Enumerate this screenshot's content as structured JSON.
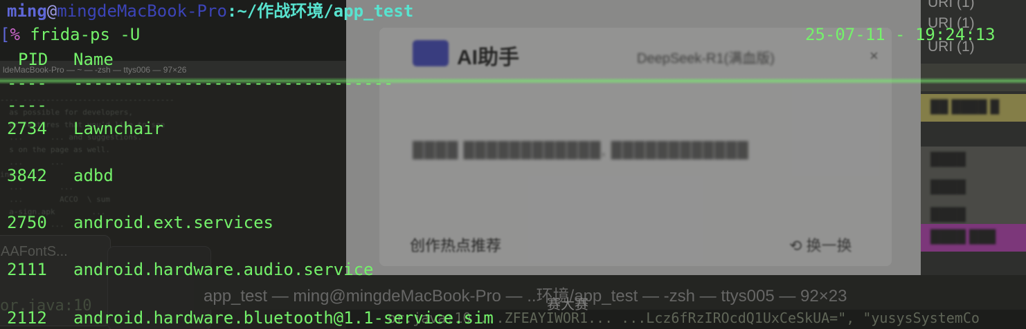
{
  "terminal": {
    "prompt": {
      "user": "ming",
      "at": "@",
      "host": "mingdeMacBook-Pro",
      "path": ":~/作战环境/app_test",
      "bracket": "[",
      "symbol": "%",
      "command": " frida-ps -U"
    },
    "clock": "25-07-11 - 19:24:13",
    "table": {
      "header_pid": "PID",
      "header_name": "Name",
      "separator_pid": "----",
      "separator_name": "--------------------------------",
      "separator_wrap": "----",
      "rows": [
        {
          "pid": "2734",
          "name": "Lawnchair"
        },
        {
          "pid": "3842",
          "name": "adbd"
        },
        {
          "pid": "2750",
          "name": "android.ext.services"
        },
        {
          "pid": "2111",
          "name": "android.hardware.audio.service"
        },
        {
          "pid": "2112",
          "name": "android.hardware.bluetooth@1.1-service.sim"
        }
      ]
    }
  },
  "background": {
    "left_window_title": "ldeMacBook-Pro — ~ — -zsh — ttys006 — 97×26",
    "aafont_label": "AAFontS...",
    "java_label": "or.java:10",
    "ai": {
      "title": "AI助手",
      "model": "DeepSeek-R1(满血版)",
      "hot_topics": "创作热点推荐",
      "refresh": "换一换",
      "close_glyph": "×"
    },
    "right_panel": {
      "uri_items": [
        "URI (1)",
        "URI (1)",
        "URI (1)"
      ]
    },
    "bottom_window_title": "app_test — ming@mingdeMacBook-Pro — ..环境/app_test — -zsh — ttys005 — 92×23",
    "bottom_text": "or.java:10  ...ZFEAYIWOR1...  ...Lcz6fRzIROcdQ1UxCeSkUA=\",  \"yusysSystemCo",
    "bottom_char": "赛大赛"
  },
  "colors": {
    "terminal_green": "#74f26a",
    "prompt_user": "#5f67d8",
    "prompt_path": "#58e3cf",
    "ai_brand": "#4f55c9"
  }
}
